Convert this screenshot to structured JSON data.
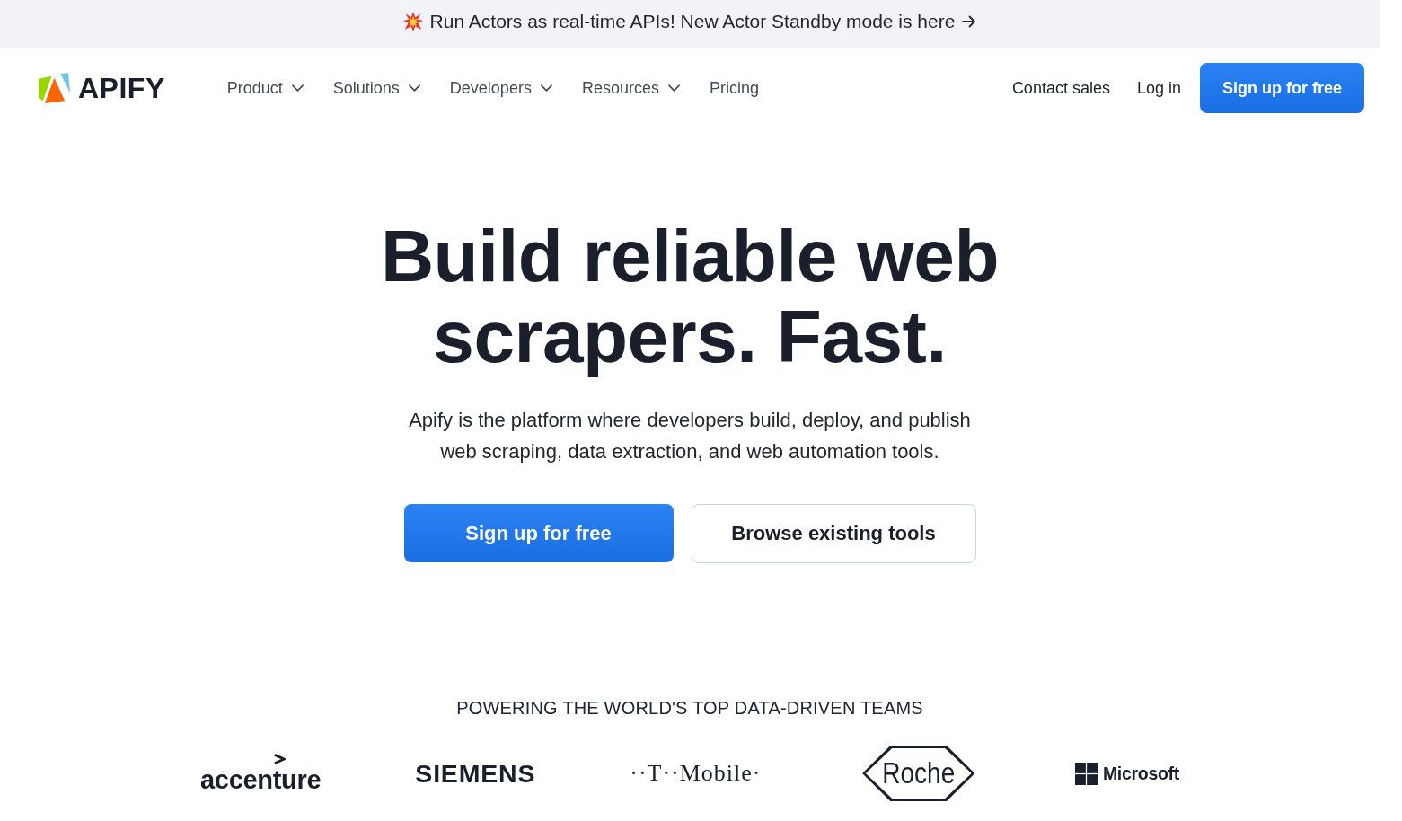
{
  "banner": {
    "text": "Run Actors as real-time APIs! New Actor Standby mode is here"
  },
  "nav": {
    "brand": "APIFY",
    "items": [
      {
        "label": "Product",
        "kind": "dropdown"
      },
      {
        "label": "Solutions",
        "kind": "dropdown"
      },
      {
        "label": "Developers",
        "kind": "dropdown"
      },
      {
        "label": "Resources",
        "kind": "dropdown"
      },
      {
        "label": "Pricing",
        "kind": "link"
      }
    ],
    "actions": [
      {
        "label": "Contact sales",
        "kind": "link"
      },
      {
        "label": "Log in",
        "kind": "link"
      },
      {
        "label": "Sign up for free",
        "kind": "primary"
      }
    ]
  },
  "hero": {
    "headline": "Build reliable web scrapers. Fast.",
    "subtitle": "Apify is the platform where developers build, deploy, and publish web scraping, data extraction, and web automation tools.",
    "buttons": [
      {
        "label": "Sign up for free",
        "kind": "primary"
      },
      {
        "label": "Browse existing tools",
        "kind": "secondary"
      }
    ]
  },
  "customers": {
    "heading": "POWERING THE WORLD'S TOP DATA-DRIVEN TEAMS",
    "logos": [
      {
        "name": "accenture",
        "kind": "accenture"
      },
      {
        "name": "SIEMENS",
        "kind": "siemens"
      },
      {
        "name": "··T··Mobile·",
        "kind": "tmobile"
      },
      {
        "name": "Roche",
        "kind": "roche"
      },
      {
        "name": "Microsoft",
        "kind": "microsoft"
      }
    ]
  }
}
